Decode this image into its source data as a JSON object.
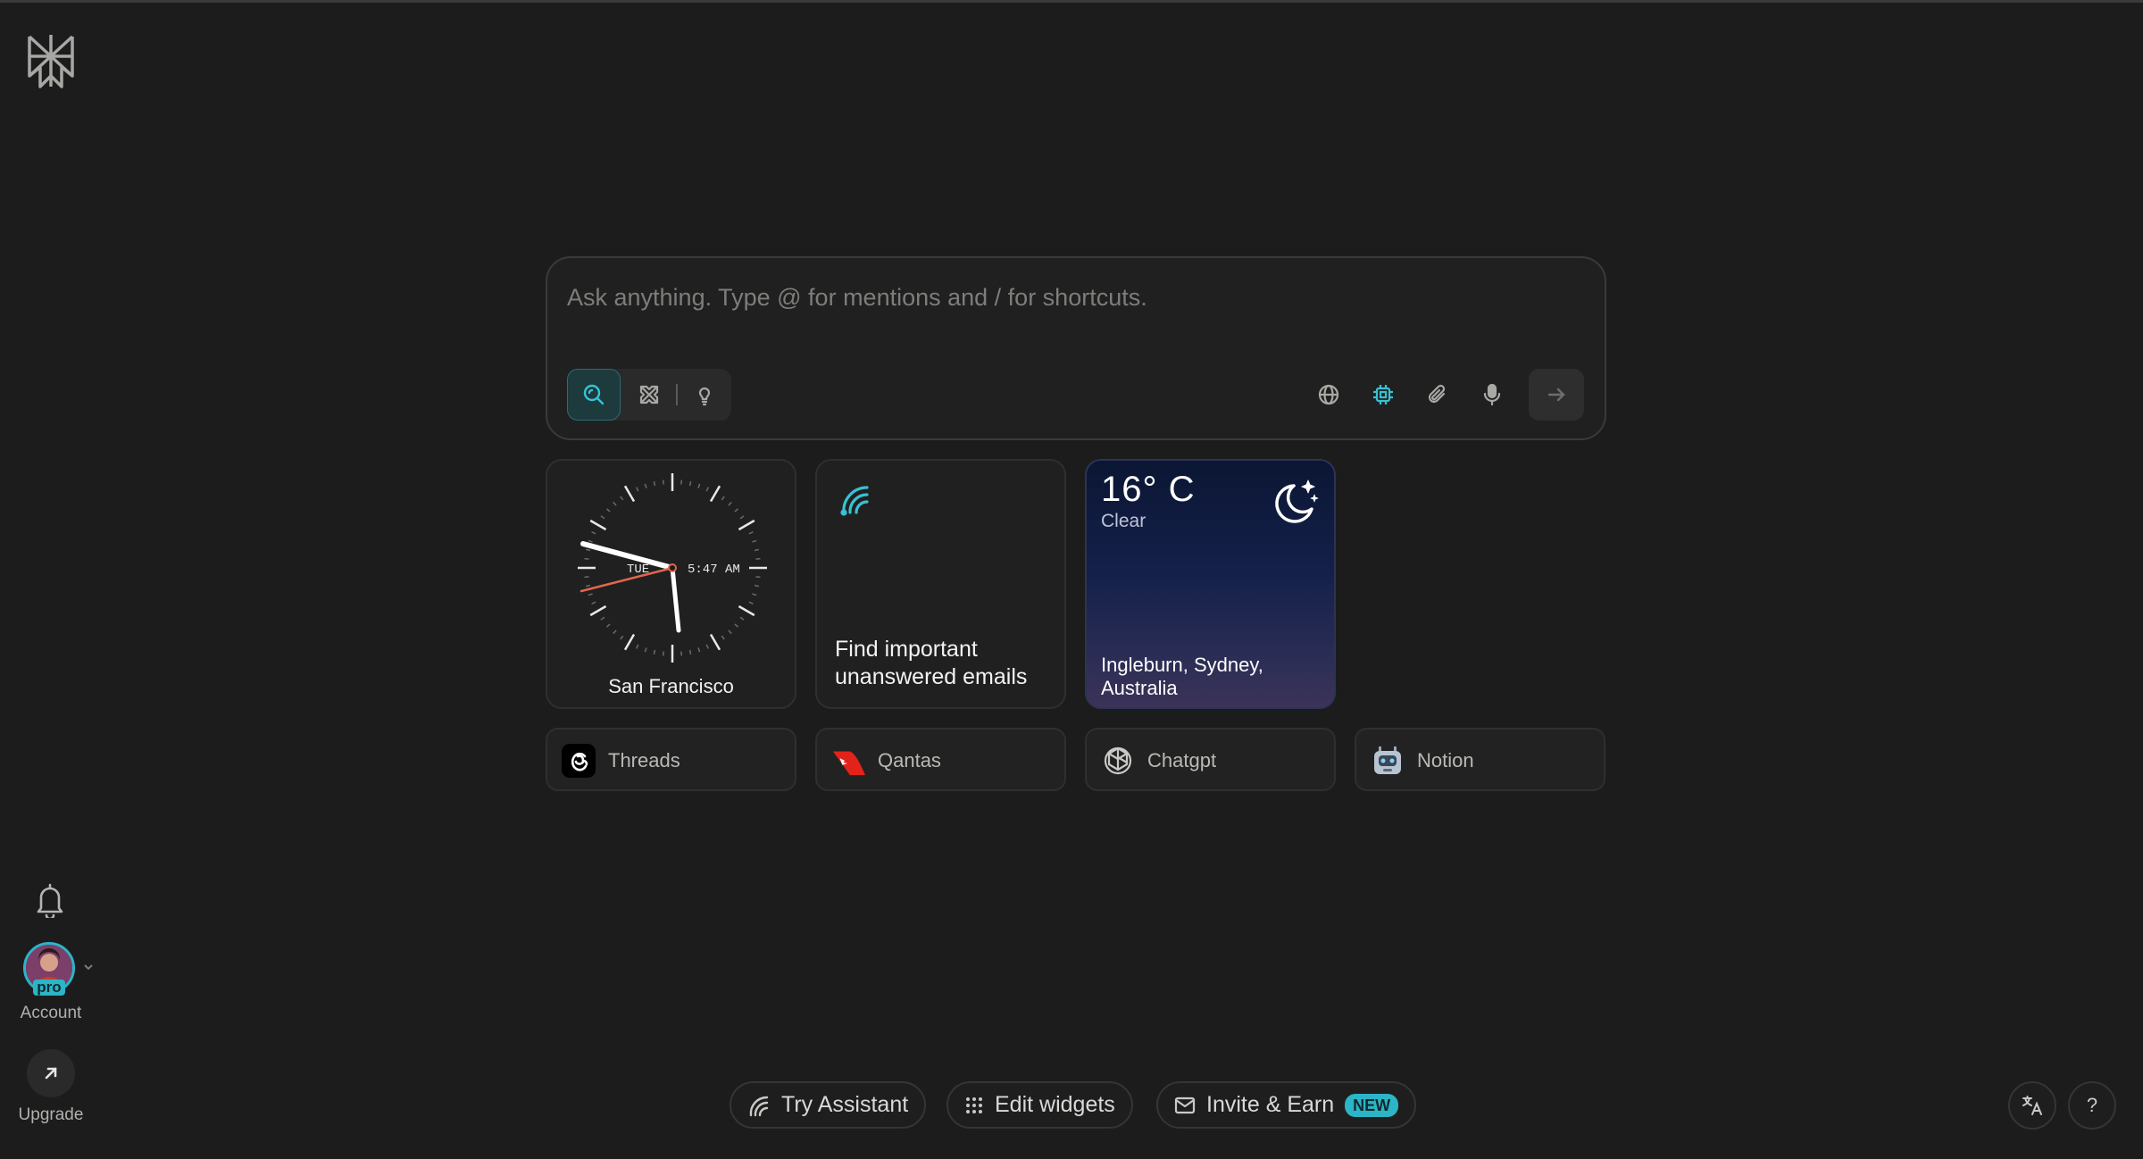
{
  "app": {
    "logo_icon": "perplexity-logo-icon",
    "accent_color": "#2bb5c6"
  },
  "rail": {
    "notifications_icon": "bell-icon",
    "account_label": "Account",
    "pro_badge": "pro",
    "upgrade_label": "Upgrade",
    "upgrade_icon": "arrow-up-right-icon"
  },
  "search": {
    "placeholder": "Ask anything. Type @ for mentions and / for shortcuts.",
    "value": "",
    "modes": [
      {
        "name": "search",
        "icon": "search-icon",
        "active": true
      },
      {
        "name": "research",
        "icon": "research-icon",
        "active": false
      },
      {
        "name": "labs",
        "icon": "lightbulb-icon",
        "active": false
      }
    ],
    "tools": [
      "globe-icon",
      "chip-icon",
      "paperclip-icon",
      "microphone-icon"
    ],
    "submit_icon": "arrow-right-icon"
  },
  "widgets": {
    "clock": {
      "day": "TUE",
      "time": "5:47 AM",
      "city": "San Francisco"
    },
    "assistant": {
      "icon": "assistant-icon",
      "text": "Find important unanswered emails"
    },
    "weather": {
      "temperature": "16° C",
      "condition": "Clear",
      "location": "Ingleburn, Sydney, Australia",
      "icon": "moon-stars-icon"
    }
  },
  "shortcuts": [
    {
      "label": "Threads",
      "icon": "threads-icon"
    },
    {
      "label": "Qantas",
      "icon": "qantas-icon"
    },
    {
      "label": "Chatgpt",
      "icon": "chatgpt-icon"
    },
    {
      "label": "Notion",
      "icon": "robot-icon"
    }
  ],
  "footer": {
    "try_assistant": "Try Assistant",
    "edit_widgets": "Edit widgets",
    "invite_earn": "Invite & Earn",
    "new_badge": "NEW",
    "language_icon": "translate-icon",
    "help_label": "?"
  }
}
